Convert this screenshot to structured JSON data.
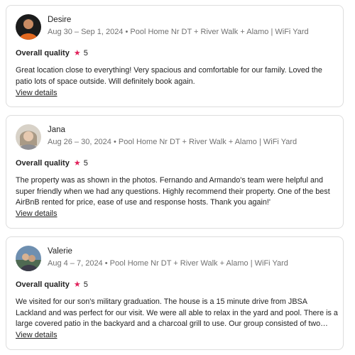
{
  "reviews": [
    {
      "name": "Desire",
      "date": "Aug 30 – Sep 1, 2024",
      "listing": "Pool Home Nr DT + River Walk + Alamo | WiFi Yard",
      "quality_label": "Overall quality",
      "star_icon": "★",
      "rating": "5",
      "text": "Great location close to everything! Very spacious and comfortable for our family. Loved the patio lots of space outside. Will definitely book again.",
      "details_label": "View details",
      "avatar_color": "#c85a1e"
    },
    {
      "name": "Jana",
      "date": "Aug 26 – 30, 2024",
      "listing": "Pool Home Nr DT + River Walk + Alamo | WiFi Yard",
      "quality_label": "Overall quality",
      "star_icon": "★",
      "rating": "5",
      "text": "The property was as shown in the photos. Fernando and Armando's team were helpful and super friendly when we had any questions. Highly recommend their property. One of the best AirBnB rented for price, ease of use and response hosts. Thank you again!'",
      "details_label": "View details",
      "avatar_color": "#b9a894"
    },
    {
      "name": "Valerie",
      "date": "Aug 4 – 7, 2024",
      "listing": "Pool Home Nr DT + River Walk + Alamo | WiFi Yard",
      "quality_label": "Overall quality",
      "star_icon": "★",
      "rating": "5",
      "text": "We visited for our son's military graduation. The house is a 15 minute drive from JBSA Lackland and was perfect for our visit. We were all able to relax in the yard and pool. There is a large covered patio in the backyard and a charcoal grill to use. Our group consisted of two families and we had plenty of room.",
      "details_label": "View details",
      "avatar_color": "#6a8cab"
    }
  ],
  "separator": " • "
}
